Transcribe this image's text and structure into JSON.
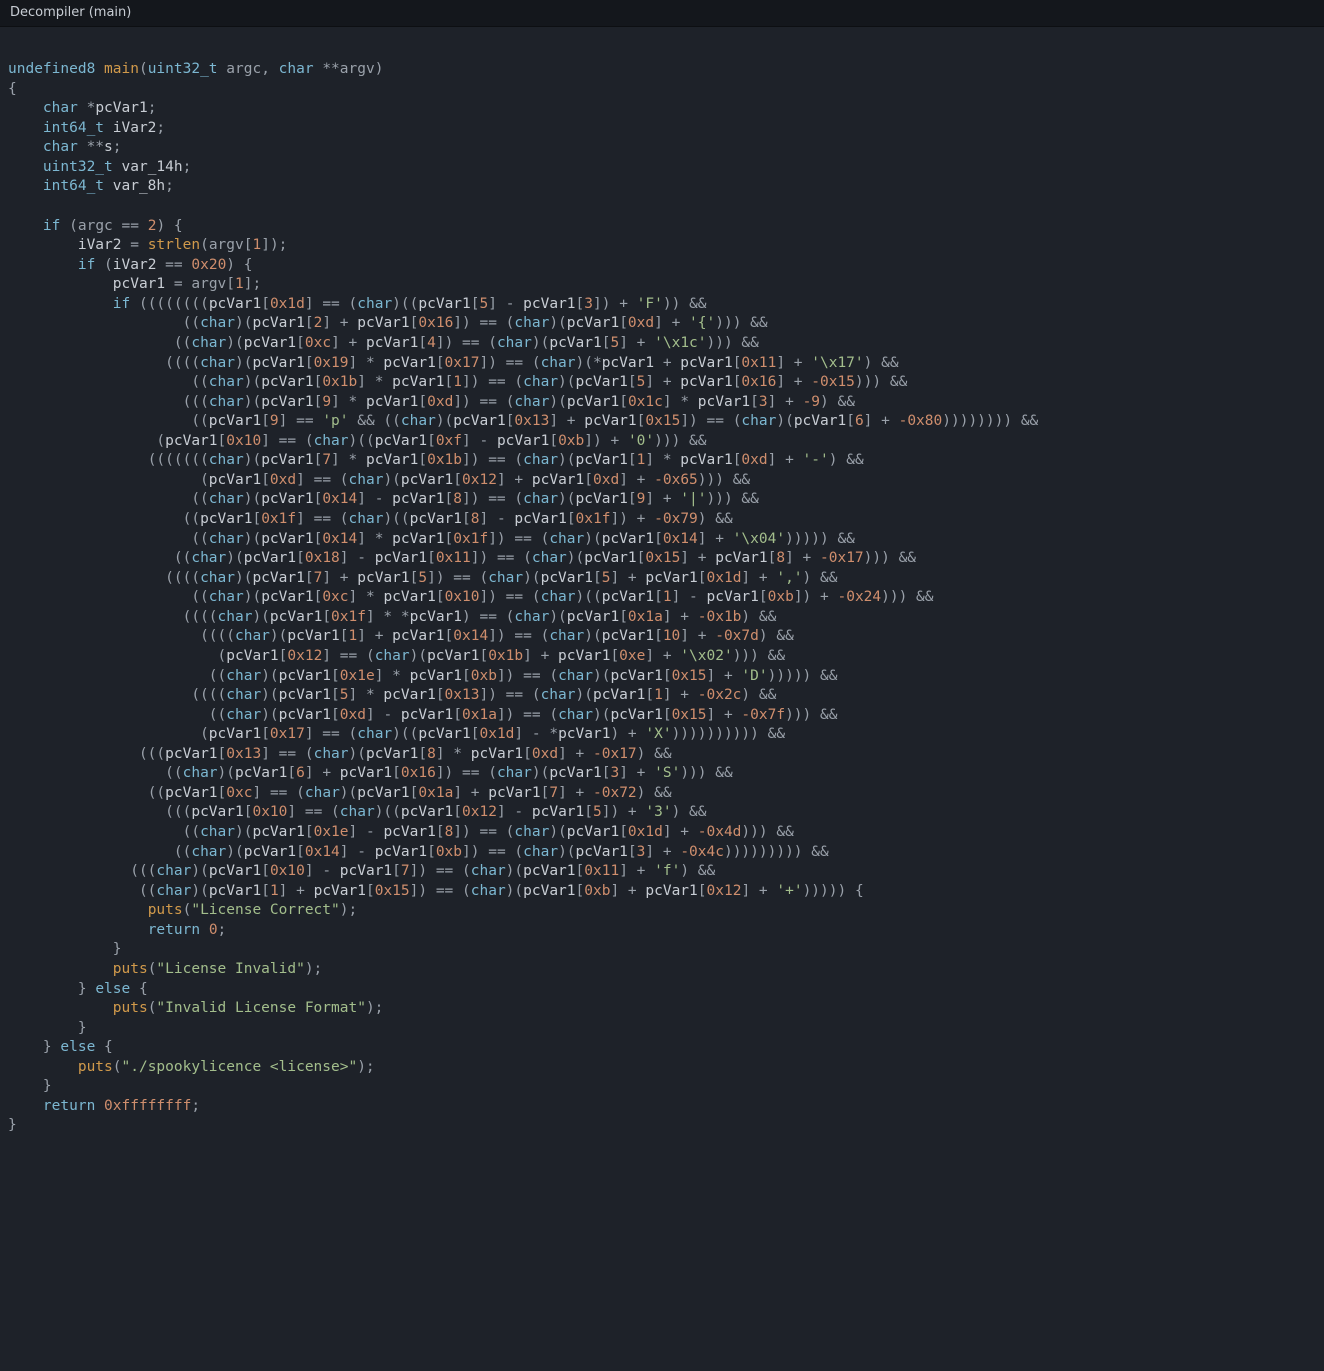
{
  "window": {
    "title": "Decompiler (main)"
  },
  "tokens": {
    "ret_type": "undefined8",
    "main": "main",
    "argc": "argc",
    "argv": "argv",
    "char": "char",
    "int64_t": "int64_t",
    "uint32_t": "uint32_t",
    "if": "if",
    "else": "else",
    "return": "return",
    "strlen": "strlen",
    "puts": "puts",
    "v_pcVar1": "pcVar1",
    "v_iVar2": "iVar2",
    "v_s": "s",
    "v_var_14h": "var_14h",
    "v_var_8h": "var_8h"
  },
  "nums": {
    "two": "2",
    "one": "1",
    "x20": "0x20",
    "x1d": "0x1d",
    "five": "5",
    "three": "3",
    "x16": "0x16",
    "xd": "0xd",
    "xc": "0xc",
    "four": "4",
    "x19": "0x19",
    "x17": "0x17",
    "x11": "0x11",
    "x1b": "0x1b",
    "mx15": "-0x15",
    "nine": "9",
    "x1c": "0x1c",
    "m9": "-9",
    "x13": "0x13",
    "x15": "0x15",
    "six": "6",
    "mx80": "-0x80",
    "x10": "0x10",
    "xf": "0xf",
    "xb": "0xb",
    "seven": "7",
    "x14": "0x14",
    "eight": "8",
    "x1f": "0x1f",
    "mx79": "-0x79",
    "x18": "0x18",
    "mx17": "-0x17",
    "mx24": "-0x24",
    "x1a": "0x1a",
    "mx1b": "-0x1b",
    "ten": "10",
    "mx7d": "-0x7d",
    "x12": "0x12",
    "xe": "0xe",
    "x1e": "0x1e",
    "mx2c": "-0x2c",
    "mx7f": "-0x7f",
    "mx72": "-0x72",
    "mx4d": "-0x4d",
    "mx4c": "-0x4c",
    "mx65": "-0x65",
    "zero": "0",
    "ret_err": "0xffffffff"
  },
  "chars": {
    "F": "'F'",
    "lbrace": "'{'",
    "x1c": "'\\x1c'",
    "x17": "'\\x17'",
    "p": "'p'",
    "zero": "'0'",
    "dash": "'-'",
    "pipe": "'|'",
    "x04": "'\\x04'",
    "comma": "','",
    "D": "'D'",
    "x02": "'\\x02'",
    "X": "'X'",
    "S": "'S'",
    "three": "'3'",
    "f": "'f'",
    "plus": "'+'"
  },
  "strings": {
    "license_correct": "\"License Correct\"",
    "license_invalid": "\"License Invalid\"",
    "invalid_format": "\"Invalid License Format\"",
    "usage": "\"./spookylicence <license>\""
  }
}
